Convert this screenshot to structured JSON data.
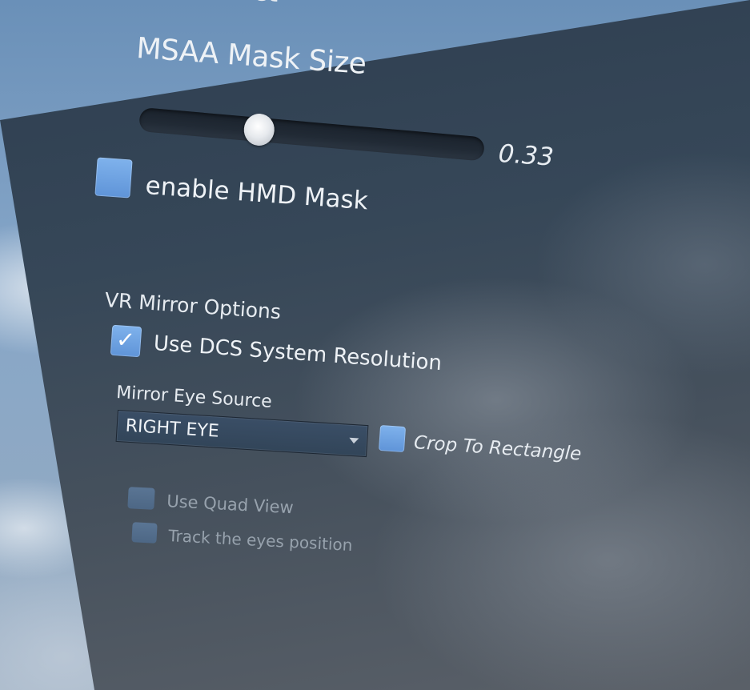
{
  "header": {
    "partial_title": "Effect"
  },
  "msaa": {
    "label": "MSAA Mask Size",
    "value": 0.33,
    "value_text": "0.33"
  },
  "hmd_mask": {
    "label": "enable HMD Mask",
    "checked": true
  },
  "vr_mirror": {
    "title": "VR Mirror Options",
    "use_dcs_resolution": {
      "label": "Use DCS System Resolution",
      "checked": true
    },
    "eye_source": {
      "label": "Mirror Eye Source",
      "selected": "RIGHT EYE"
    },
    "crop_to_rectangle": {
      "label": "Crop To Rectangle",
      "checked": false
    },
    "use_quad_view": {
      "label": "Use Quad View",
      "checked": false,
      "enabled": false
    },
    "track_eyes": {
      "label": "Track the eyes position",
      "checked": false,
      "enabled": false
    }
  },
  "colors": {
    "checkbox_accent": "#6aa1e2",
    "panel_bg": "#364758",
    "disabled_text": "#97a2ad"
  },
  "icons": {
    "check": "check-icon",
    "dropdown": "chevron-down-icon"
  }
}
